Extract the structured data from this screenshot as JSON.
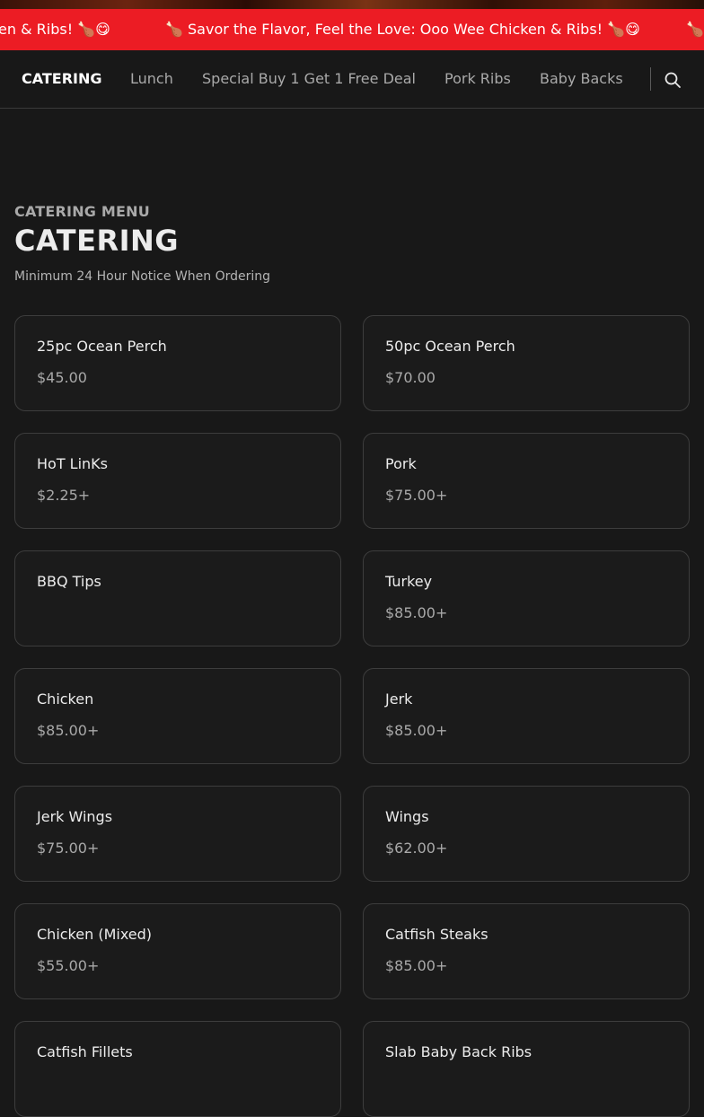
{
  "ticker": {
    "segment_left": "en & Ribs! 🍗😋",
    "segment_main": "🍗 Savor the Flavor, Feel the Love: Ooo Wee Chicken & Ribs! 🍗😋",
    "segment_right": "🍗 S"
  },
  "nav": {
    "items": [
      {
        "label": "CATERING"
      },
      {
        "label": "Lunch"
      },
      {
        "label": "Special Buy 1 Get 1 Free Deal"
      },
      {
        "label": "Pork Ribs"
      },
      {
        "label": "Baby Backs"
      }
    ],
    "search_icon": "search-icon"
  },
  "section": {
    "eyebrow": "CATERING MENU",
    "title": "CATERING",
    "note": "Minimum 24 Hour Notice When Ordering"
  },
  "items": [
    {
      "name": "25pc Ocean Perch",
      "price": "$45.00"
    },
    {
      "name": "50pc Ocean Perch",
      "price": "$70.00"
    },
    {
      "name": "HoT LinKs",
      "price": "$2.25+"
    },
    {
      "name": "Pork",
      "price": "$75.00+"
    },
    {
      "name": "BBQ Tips",
      "price": ""
    },
    {
      "name": "Turkey",
      "price": "$85.00+"
    },
    {
      "name": "Chicken",
      "price": "$85.00+"
    },
    {
      "name": "Jerk",
      "price": "$85.00+"
    },
    {
      "name": "Jerk Wings",
      "price": "$75.00+"
    },
    {
      "name": "Wings",
      "price": "$62.00+"
    },
    {
      "name": "Chicken (Mixed)",
      "price": "$55.00+"
    },
    {
      "name": "Catfish Steaks",
      "price": "$85.00+"
    },
    {
      "name": "Catfish Fillets",
      "price": ""
    },
    {
      "name": "Slab Baby Back Ribs",
      "price": ""
    }
  ],
  "colors": {
    "ticker_bg": "#ec1c24",
    "page_bg": "#181818",
    "card_border": "#3d3d3d"
  }
}
